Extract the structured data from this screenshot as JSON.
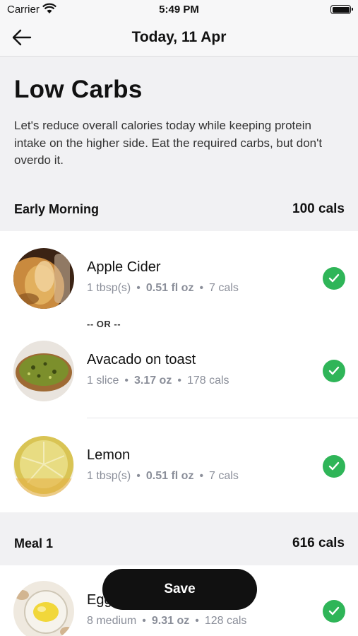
{
  "status_bar": {
    "carrier": "Carrier",
    "time": "5:49 PM"
  },
  "nav": {
    "title": "Today, 11 Apr"
  },
  "plan": {
    "title": "Low Carbs",
    "description": "Let's reduce overall calories today while keeping protein intake on the higher side. Eat the required carbs, but don't overdo it."
  },
  "sections": [
    {
      "name": "Early Morning",
      "cals": "100 cals",
      "or_label": "-- OR --",
      "items": [
        {
          "name": "Apple Cider",
          "qty": "1 tbsp(s)",
          "weight": "0.51 fl oz",
          "cals": "7 cals",
          "checked": true
        },
        {
          "name": "Avacado on toast",
          "qty": "1 slice",
          "weight": "3.17 oz",
          "cals": "178 cals",
          "checked": true
        },
        {
          "name": "Lemon",
          "qty": "1 tbsp(s)",
          "weight": "0.51 fl oz",
          "cals": "7 cals",
          "checked": true
        }
      ]
    },
    {
      "name": "Meal 1",
      "cals": "616 cals",
      "items": [
        {
          "name": "Eggs",
          "qty": "8 medium",
          "weight": "9.31 oz",
          "cals": "128 cals",
          "checked": true
        }
      ]
    }
  ],
  "save_label": "Save",
  "colors": {
    "check": "#2fb558",
    "button": "#111111",
    "section_bg": "#f1f1f3"
  }
}
